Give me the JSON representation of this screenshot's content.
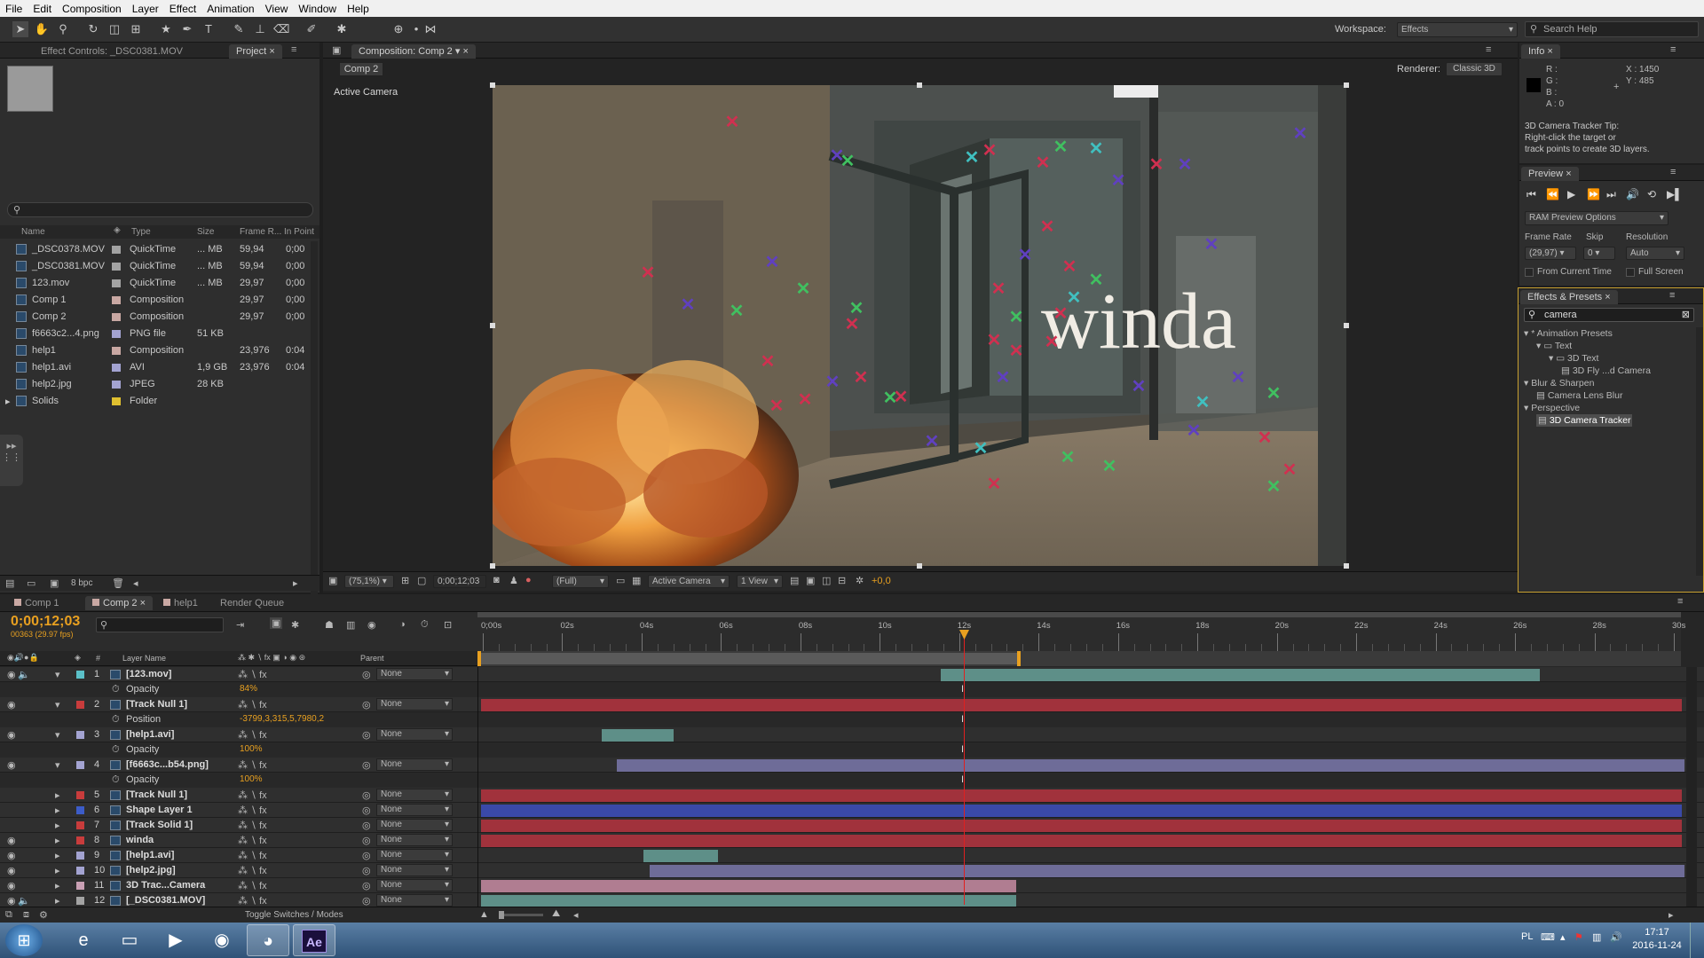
{
  "menu": [
    "File",
    "Edit",
    "Composition",
    "Layer",
    "Effect",
    "Animation",
    "View",
    "Window",
    "Help"
  ],
  "toolbar": {
    "workspace_label": "Workspace:",
    "workspace_value": "Effects",
    "search_placeholder": "Search Help"
  },
  "left_panel": {
    "tab_effect_controls": "Effect Controls: _DSC0381.MOV",
    "tab_project": "Project",
    "columns": {
      "name": "Name",
      "type": "Type",
      "size": "Size",
      "frame_rate": "Frame R...",
      "in_point": "In Point"
    },
    "items": [
      {
        "name": "_DSC0378.MOV",
        "type": "QuickTime",
        "size": "... MB",
        "fps": "59,94",
        "in": "0;00",
        "color": "#a3a3a3",
        "icon": "film-icon"
      },
      {
        "name": "_DSC0381.MOV",
        "type": "QuickTime",
        "size": "... MB",
        "fps": "59,94",
        "in": "0;00",
        "color": "#a3a3a3",
        "icon": "film-icon"
      },
      {
        "name": "123.mov",
        "type": "QuickTime",
        "size": "... MB",
        "fps": "29,97",
        "in": "0;00",
        "color": "#a3a3a3",
        "icon": "film-icon"
      },
      {
        "name": "Comp 1",
        "type": "Composition",
        "size": "",
        "fps": "29,97",
        "in": "0;00",
        "color": "#c9a8a3",
        "icon": "comp-icon"
      },
      {
        "name": "Comp 2",
        "type": "Composition",
        "size": "",
        "fps": "29,97",
        "in": "0;00",
        "color": "#c9a8a3",
        "icon": "comp-icon"
      },
      {
        "name": "f6663c2...4.png",
        "type": "PNG file",
        "size": "51 KB",
        "fps": "",
        "in": "",
        "color": "#a3a3d1",
        "icon": "image-icon"
      },
      {
        "name": "help1",
        "type": "Composition",
        "size": "",
        "fps": "23,976",
        "in": "0:04",
        "color": "#c9a8a3",
        "icon": "comp-icon"
      },
      {
        "name": "help1.avi",
        "type": "AVI",
        "size": "1,9 GB",
        "fps": "23,976",
        "in": "0:04",
        "color": "#a3a3d1",
        "icon": "film-icon"
      },
      {
        "name": "help2.jpg",
        "type": "JPEG",
        "size": "28 KB",
        "fps": "",
        "in": "",
        "color": "#a3a3d1",
        "icon": "image-icon"
      },
      {
        "name": "Solids",
        "type": "Folder",
        "size": "",
        "fps": "",
        "in": "",
        "color": "#e0c030",
        "icon": "folder-icon"
      }
    ],
    "bpc": "8 bpc"
  },
  "composition": {
    "tab": "Composition: Comp 2",
    "comp_button": "Comp 2",
    "renderer_label": "Renderer:",
    "renderer_value": "Classic 3D",
    "active_camera_label": "Active Camera",
    "overlay_text": "winda",
    "zoom": "(75,1%)",
    "timecode": "0;00;12;03",
    "resolution": "(Full)",
    "camera": "Active Camera",
    "view": "1 View",
    "exposure": "+0,0"
  },
  "info": {
    "tab": "Info",
    "r": "R :",
    "g": "G :",
    "b": "B :",
    "a": "A : 0",
    "x": "X : 1450",
    "y": "Y : 485",
    "tip": [
      "3D Camera Tracker Tip:",
      "Right-click the target or",
      "track points to create 3D layers."
    ]
  },
  "preview": {
    "tab": "Preview",
    "ram_options": "RAM Preview Options",
    "frame_rate_label": "Frame Rate",
    "skip_label": "Skip",
    "resolution_label": "Resolution",
    "frame_rate_value": "(29,97)",
    "skip_value": "0",
    "resolution_value": "Auto",
    "from_current": "From Current Time",
    "full_screen": "Full Screen"
  },
  "effects_presets": {
    "tab": "Effects & Presets",
    "search_value": "camera",
    "tree": [
      {
        "label": "* Animation Presets",
        "level": 0,
        "icon": ""
      },
      {
        "label": "Text",
        "level": 1,
        "icon": "folder-icon"
      },
      {
        "label": "3D Text",
        "level": 2,
        "icon": "folder-icon"
      },
      {
        "label": "3D Fly ...d Camera",
        "level": 3,
        "icon": "preset-icon"
      },
      {
        "label": "Blur & Sharpen",
        "level": 0,
        "icon": ""
      },
      {
        "label": "Camera Lens Blur",
        "level": 1,
        "icon": "effect-icon"
      },
      {
        "label": "Perspective",
        "level": 0,
        "icon": ""
      },
      {
        "label": "3D Camera Tracker",
        "level": 1,
        "icon": "effect-icon",
        "selected": true
      }
    ]
  },
  "timeline": {
    "tabs": [
      "Comp 1",
      "Comp 2",
      "help1",
      "Render Queue"
    ],
    "current_time": "0;00;12;03",
    "frame_info": "00363 (29.97 fps)",
    "ruler": [
      "0;00s",
      "02s",
      "04s",
      "06s",
      "08s",
      "10s",
      "12s",
      "14s",
      "16s",
      "18s",
      "20s",
      "22s",
      "24s",
      "26s",
      "28s",
      "30s"
    ],
    "col_layer_name": "Layer Name",
    "col_parent": "Parent",
    "col_hash": "#",
    "layers": [
      {
        "num": "1",
        "name": "[123.mov]",
        "label": "#5bc0c8",
        "icon": "film-icon",
        "sub": "Opacity",
        "subval": "84%",
        "bar_start": 0.382,
        "bar_end": 0.88,
        "bar_color": "#5e8f88",
        "parent": "None",
        "video": true,
        "audio": true
      },
      {
        "num": "2",
        "name": "[Track Null 1]",
        "label": "#c83c3c",
        "icon": "null-icon",
        "sub": "Position",
        "subval": "-3799,3,315,5,7980,2",
        "bar_start": 0.0,
        "bar_end": 0.998,
        "bar_color": "#a1323c",
        "parent": "None",
        "video": true,
        "audio": false
      },
      {
        "num": "3",
        "name": "[help1.avi]",
        "label": "#a3a3d1",
        "icon": "film-icon",
        "sub": "Opacity",
        "subval": "100%",
        "bar_start": 0.1,
        "bar_end": 0.16,
        "bar_color": "#5e8f88",
        "parent": "None",
        "video": true,
        "audio": false
      },
      {
        "num": "4",
        "name": "[f6663c...b54.png]",
        "label": "#a3a3d1",
        "icon": "image-icon",
        "sub": "Opacity",
        "subval": "100%",
        "bar_start": 0.113,
        "bar_end": 1.0,
        "bar_color": "#6e6c98",
        "parent": "None",
        "video": true,
        "audio": false
      },
      {
        "num": "5",
        "name": "[Track Null 1]",
        "label": "#c83c3c",
        "icon": "null-icon",
        "bar_start": 0.0,
        "bar_end": 0.998,
        "bar_color": "#a1323c",
        "parent": "None",
        "video": false
      },
      {
        "num": "6",
        "name": "Shape Layer 1",
        "label": "#3c5cc8",
        "icon": "star-icon",
        "bar_start": 0.0,
        "bar_end": 0.998,
        "bar_color": "#3a49a8",
        "parent": "None",
        "video": false
      },
      {
        "num": "7",
        "name": "[Track Solid 1]",
        "label": "#c83c3c",
        "icon": "solid-icon",
        "bar_start": 0.0,
        "bar_end": 0.998,
        "bar_color": "#a1323c",
        "parent": "None",
        "video": false
      },
      {
        "num": "8",
        "name": "winda",
        "label": "#c83c3c",
        "icon": "text-icon",
        "bar_start": 0.0,
        "bar_end": 0.998,
        "bar_color": "#a1323c",
        "parent": "None",
        "video": true
      },
      {
        "num": "9",
        "name": "[help1.avi]",
        "label": "#a3a3d1",
        "icon": "film-icon",
        "bar_start": 0.135,
        "bar_end": 0.197,
        "bar_color": "#5e8f88",
        "parent": "None",
        "video": true
      },
      {
        "num": "10",
        "name": "[help2.jpg]",
        "label": "#a3a3d1",
        "icon": "image-icon",
        "bar_start": 0.14,
        "bar_end": 1.0,
        "bar_color": "#6e6c98",
        "parent": "None",
        "video": true
      },
      {
        "num": "11",
        "name": "3D Trac...Camera",
        "label": "#c9a0b4",
        "icon": "camera-icon",
        "bar_start": 0.0,
        "bar_end": 0.445,
        "bar_color": "#b07d91",
        "parent": "None",
        "video": true
      },
      {
        "num": "12",
        "name": "[_DSC0381.MOV]",
        "label": "#a3a3a3",
        "icon": "film-icon",
        "bar_start": 0.0,
        "bar_end": 0.445,
        "bar_color": "#5e8f88",
        "parent": "None",
        "video": true,
        "audio": true
      }
    ],
    "toggle_label": "Toggle Switches / Modes"
  },
  "taskbar": {
    "lang": "PL",
    "time": "17:17",
    "date": "2016-11-24",
    "apps": [
      "start-icon",
      "ie-icon",
      "explorer-icon",
      "media-icon",
      "chrome-icon",
      "firefox-icon",
      "ae-icon"
    ],
    "ae_label": "Ae"
  },
  "colors": {
    "accent": "#e8a020",
    "playhead": "#e02020",
    "panel": "#2e2e2e"
  }
}
